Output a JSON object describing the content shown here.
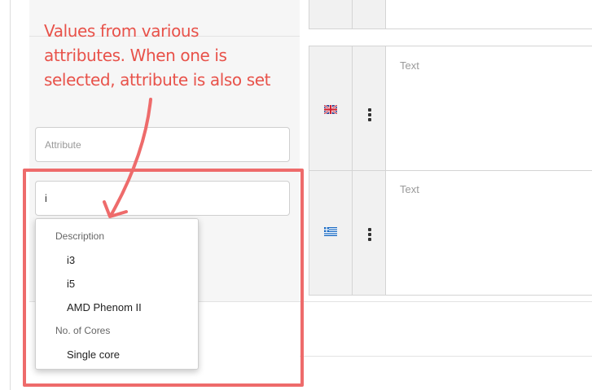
{
  "annotation": {
    "lines": [
      "Values from various",
      "attributes. When one is",
      "selected, attribute is also set"
    ],
    "color": "#e8524a"
  },
  "form": {
    "attribute_placeholder": "Attribute",
    "value_input": "i"
  },
  "translations": [
    {
      "flag_icon": "uk-flag-icon",
      "placeholder": "Text"
    },
    {
      "flag_icon": "greece-flag-icon",
      "placeholder": "Text"
    }
  ],
  "dropdown": {
    "groups": [
      {
        "label": "Description",
        "items": [
          "i3",
          "i5",
          "AMD Phenom II"
        ]
      },
      {
        "label": "No. of Cores",
        "items": [
          "Single core"
        ]
      }
    ]
  },
  "colors": {
    "highlight": "#ee6b6b",
    "panel_bg": "#f6f6f6"
  }
}
